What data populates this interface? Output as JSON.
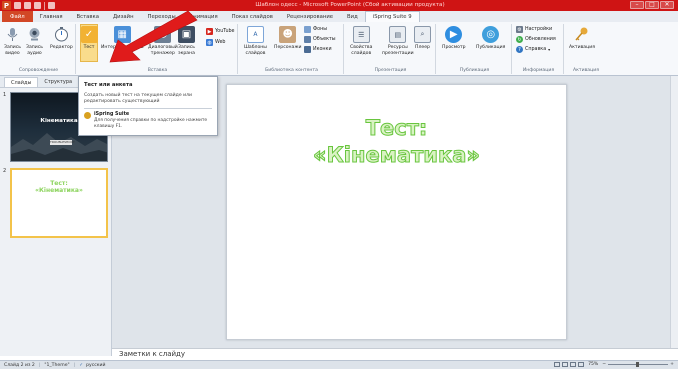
{
  "window": {
    "app_icon": "P",
    "title": "Шаблон одесс - Microsoft PowerPoint (Сбой активации продукта)",
    "controls": [
      "–",
      "□",
      "✕"
    ]
  },
  "tabs": [
    "Файл",
    "Главная",
    "Вставка",
    "Дизайн",
    "Переходы",
    "Анимация",
    "Показ слайдов",
    "Рецензирование",
    "Вид",
    "iSpring Suite 9"
  ],
  "ribbon": {
    "groups": {
      "narration": "Сопровождение",
      "insert": "Вставка",
      "content_library": "Библиотека контента",
      "presentation": "Презентация",
      "publish": "Публикация",
      "info": "Информация",
      "activation": "Активация"
    },
    "buttons": {
      "record_video": "Запись\nвидео",
      "record_audio": "Запись\nаудио",
      "editor": "Редактор",
      "quiz": "Тест",
      "interaction": "Интерактивность",
      "dialog_sim": "Диалоговый\nтренажер",
      "screen_record": "Запись\nэкрана",
      "youtube": "YouTube",
      "web": "Web",
      "templates": "Шаблоны\nслайдов",
      "characters": "Персонажи",
      "backgrounds": "Фоны",
      "objects": "Объекты",
      "icons": "Иконки",
      "slide_props": "Свойства\nслайдов",
      "resources": "Ресурсы\nпрезентации",
      "player": "Плеер",
      "preview": "Просмотр",
      "publish": "Публикация",
      "settings": "Настройки",
      "updates": "Обновления",
      "help": "Справка",
      "activation": "Активация"
    }
  },
  "tooltip": {
    "title": "Тест или анкета",
    "description": "Создать новый тест на текущем слайде или редактировать существующий",
    "help_title": "iSpring Suite",
    "help_desc": "Для получения справки по надстройке нажмите клавишу F1."
  },
  "pane": {
    "tabs": [
      "Слайды",
      "Структура"
    ],
    "close": "×",
    "slides": [
      {
        "num": "1",
        "title": "Кінематика",
        "subtitle": "TROUBLESHOOT"
      },
      {
        "num": "2",
        "title": "Тест:\n«Кінематика»"
      }
    ]
  },
  "slide": {
    "title": "Тест:\n«Кінематика»"
  },
  "notes": {
    "placeholder": "Заметки к слайду"
  },
  "status": {
    "slide": "Слайд 2 из 2",
    "theme": "\"1_Theme\"",
    "language": "русский",
    "zoom": "75%"
  },
  "colors": {
    "title_bar": "#cf1414",
    "file_tab": "#d24726",
    "title_text_fill": "#d9f3c3",
    "title_text_stroke": "#69c53f",
    "arrow": "#e01b1b"
  }
}
